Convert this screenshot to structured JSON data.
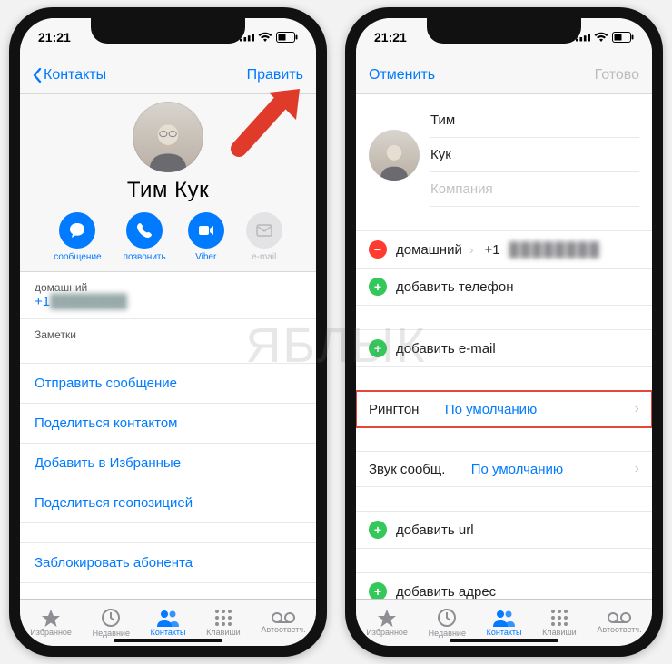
{
  "status": {
    "time": "21:21"
  },
  "phone1": {
    "nav": {
      "back": "Контакты",
      "edit": "Править"
    },
    "contact_name": "Тим  Кук",
    "actions": {
      "message": "сообщение",
      "call": "позвонить",
      "viber": "Viber",
      "email": "e-mail"
    },
    "phone_label": "домашний",
    "phone_value": "+1",
    "notes": "Заметки",
    "links": {
      "send_message": "Отправить сообщение",
      "share_contact": "Поделиться контактом",
      "add_favorite": "Добавить в Избранные",
      "share_location": "Поделиться геопозицией",
      "block": "Заблокировать абонента"
    }
  },
  "phone2": {
    "nav": {
      "cancel": "Отменить",
      "done": "Готово"
    },
    "first_name": "Тим",
    "last_name": "Кук",
    "company_placeholder": "Компания",
    "rows": {
      "home": "домашний",
      "home_value": "+1",
      "add_phone": "добавить телефон",
      "add_email": "добавить e-mail",
      "ringtone_label": "Рингтон",
      "ringtone_value": "По умолчанию",
      "text_tone_label": "Звук сообщ.",
      "text_tone_value": "По умолчанию",
      "add_url": "добавить url",
      "add_address": "добавить адрес"
    }
  },
  "tabs": {
    "favorites": "Избранное",
    "recents": "Недавние",
    "contacts": "Контакты",
    "keypad": "Клавиши",
    "voicemail": "Автоответч."
  },
  "watermark": "ЯБЛЫК"
}
